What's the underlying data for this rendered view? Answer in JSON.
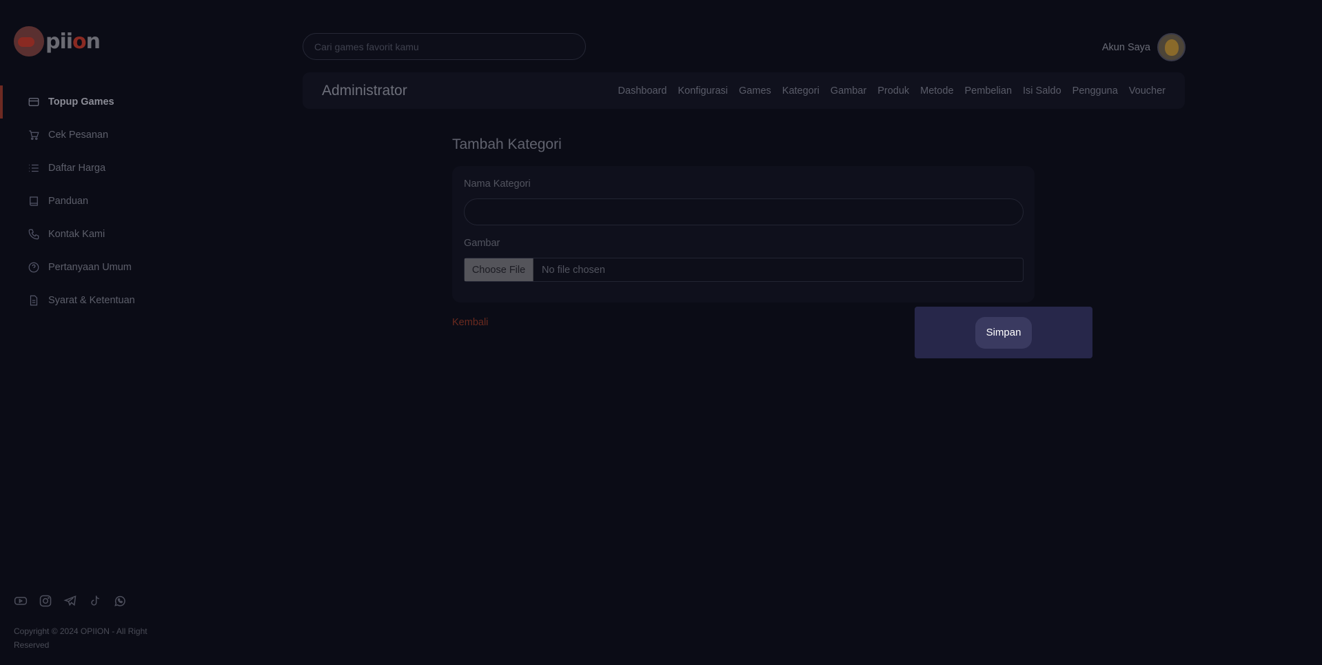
{
  "brand": {
    "logo_text_pre": "pii",
    "logo_text_o": "o",
    "logo_text_post": "n"
  },
  "sidebar": {
    "items": [
      {
        "label": "Topup Games",
        "icon": "credit-card-icon",
        "active": true
      },
      {
        "label": "Cek Pesanan",
        "icon": "cart-icon",
        "active": false
      },
      {
        "label": "Daftar Harga",
        "icon": "list-icon",
        "active": false
      },
      {
        "label": "Panduan",
        "icon": "book-icon",
        "active": false
      },
      {
        "label": "Kontak Kami",
        "icon": "phone-icon",
        "active": false
      },
      {
        "label": "Pertanyaan Umum",
        "icon": "help-circle-icon",
        "active": false
      },
      {
        "label": "Syarat & Ketentuan",
        "icon": "document-icon",
        "active": false
      }
    ],
    "socials": [
      "youtube-icon",
      "instagram-icon",
      "telegram-icon",
      "tiktok-icon",
      "whatsapp-icon"
    ],
    "copyright": "Copyright © 2024 OPIION - All Right Reserved"
  },
  "header": {
    "search_placeholder": "Cari games favorit kamu",
    "account_label": "Akun Saya"
  },
  "adminbar": {
    "title": "Administrator",
    "links": [
      "Dashboard",
      "Konfigurasi",
      "Games",
      "Kategori",
      "Gambar",
      "Produk",
      "Metode",
      "Pembelian",
      "Isi Saldo",
      "Pengguna",
      "Voucher"
    ]
  },
  "form": {
    "title": "Tambah Kategori",
    "name_label": "Nama Kategori",
    "name_value": "",
    "image_label": "Gambar",
    "file_button": "Choose File",
    "file_status": "No file chosen",
    "back_label": "Kembali",
    "save_label": "Simpan"
  },
  "colors": {
    "background": "#0b0c16",
    "accent": "#6e2a22",
    "modal": "#27274a"
  }
}
